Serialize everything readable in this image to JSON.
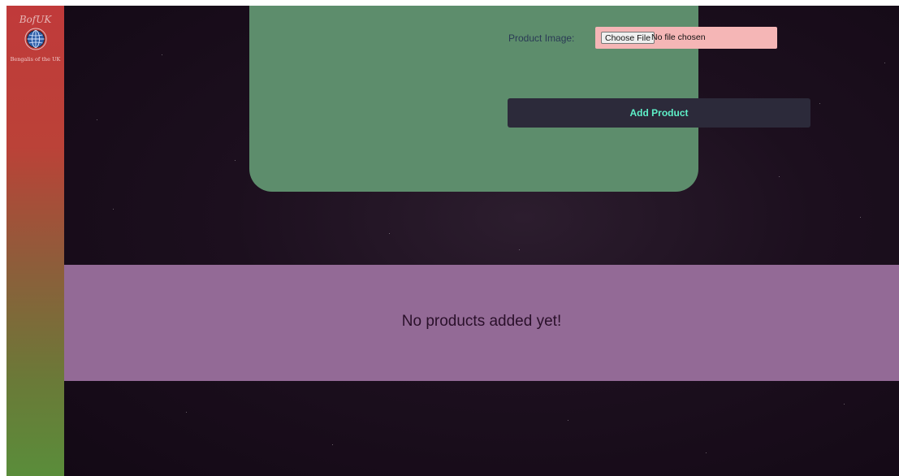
{
  "sidebar": {
    "logo_title": "BofUK",
    "logo_icon": "globe-icon",
    "logo_subtitle": "Bengalis of the UK",
    "gradient_colors": [
      "#c03a3a",
      "#8e5d3a",
      "#5a8d3a"
    ]
  },
  "form": {
    "image_label": "Product Image:",
    "file_button_label": "Choose File",
    "file_status": "No file chosen",
    "submit_label": "Add Product",
    "card_color": "#5d8d6c",
    "file_box_color": "#f5b6b6",
    "submit_color": "#2c2a3a",
    "submit_text_color": "#5ef0c8"
  },
  "products": {
    "empty_message": "No products added yet!",
    "band_color": "#936a96"
  },
  "background": {
    "color": "#1c0f1e"
  }
}
